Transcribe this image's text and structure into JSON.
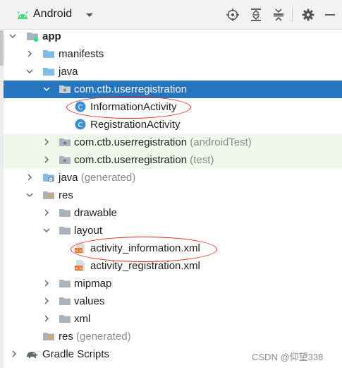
{
  "toolbar": {
    "view_label": "Android",
    "buttons": [
      "locate-icon",
      "expand-all-icon",
      "collapse-all-icon",
      "gear-icon",
      "minimize-icon"
    ]
  },
  "colors": {
    "selection": "#2675bf",
    "test_folder_tint": "#eff8eb",
    "annotation": "#e0261f",
    "android_green": "#3ddc84",
    "class_icon": "#3a8fd6"
  },
  "tree": {
    "app": "app",
    "manifests": "manifests",
    "java": "java",
    "pkg_main": "com.ctb.userregistration",
    "information_activity": "InformationActivity",
    "registration_activity": "RegistrationActivity",
    "pkg_android_test": "com.ctb.userregistration",
    "pkg_android_test_suffix": "(androidTest)",
    "pkg_test": "com.ctb.userregistration",
    "pkg_test_suffix": "(test)",
    "java_generated": "java",
    "java_generated_suffix": "(generated)",
    "res": "res",
    "drawable": "drawable",
    "layout": "layout",
    "activity_information_xml": "activity_information.xml",
    "activity_registration_xml": "activity_registration.xml",
    "mipmap": "mipmap",
    "values": "values",
    "xml": "xml",
    "res_generated": "res",
    "res_generated_suffix": "(generated)",
    "gradle_scripts": "Gradle Scripts"
  },
  "watermark": "CSDN @仰望338"
}
